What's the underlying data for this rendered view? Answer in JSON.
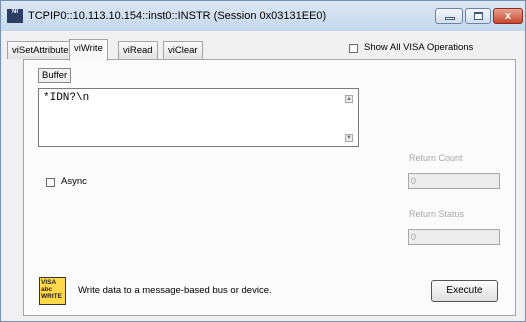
{
  "window": {
    "title": "TCPIP0::10.113.10.154::inst0::INSTR (Session 0x03131EE0)",
    "app_icon_text": "NI",
    "close_glyph": "x"
  },
  "tabs": [
    {
      "label": "viSetAttribute",
      "active": false
    },
    {
      "label": "viWrite",
      "active": true
    },
    {
      "label": "viRead",
      "active": false
    },
    {
      "label": "viClear",
      "active": false
    }
  ],
  "show_all": {
    "label": "Show All VISA Operations",
    "checked": false
  },
  "buffer": {
    "label": "Buffer",
    "value": "*IDN?\\n"
  },
  "async": {
    "label": "Async",
    "checked": false
  },
  "return_count": {
    "label": "Return Count",
    "value": "0"
  },
  "return_status": {
    "label": "Return Status",
    "value": "0"
  },
  "footer": {
    "icon_text": "VISA abc WRITE",
    "description": "Write data to a message-based bus or device.",
    "execute_label": "Execute"
  }
}
